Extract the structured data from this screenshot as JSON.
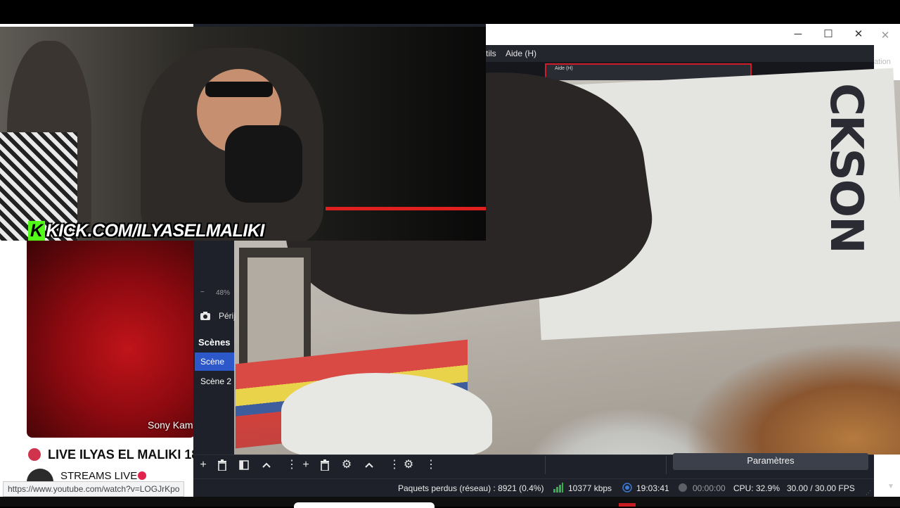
{
  "browser": {
    "video_caption": "Sony Kam",
    "live_title": "LIVE ILYAS EL MALIKI 18",
    "channel_name": "STREAMS LIVE",
    "status_url": "https://www.youtube.com/watch?v=LOGJrKpo"
  },
  "overlay": {
    "kick_logo_k": "K",
    "kick_logo_text": "KICK.COM/ILYASELMALIKI"
  },
  "obs": {
    "menu": {
      "tools_partial": "tils",
      "help": "Aide (H)"
    },
    "outer_window_partial_label": "ation",
    "nested_menu_label": "Aide (H)",
    "window_buttons": {
      "minimize": "─",
      "maximize": "☐",
      "close": "✕"
    },
    "outer_close": "✕",
    "preview": {
      "poster_text": "CKSON"
    },
    "zoom": {
      "minus": "−",
      "value": "48%"
    },
    "sources": {
      "first_label": "Périj"
    },
    "scenes": {
      "header": "Scènes",
      "items": [
        {
          "label": "Scène",
          "selected": true
        },
        {
          "label": "Scène 2",
          "selected": false
        }
      ]
    },
    "toolbar": {
      "settings_label": "Paramètres"
    },
    "status": {
      "dropped": "Paquets perdus (réseau) : 8921 (0.4%)",
      "bitrate": "10377 kbps",
      "live_time": "19:03:41",
      "rec_time": "00:00:00",
      "cpu": "CPU: 32.9%",
      "fps": "30.00 / 30.00 FPS"
    }
  },
  "colors": {
    "obs_bg": "#1f212a",
    "selected_scene": "#2d58c9",
    "kick_green": "#53fc18",
    "live_red": "#d0344c",
    "bitrate_green": "#2fb344",
    "live_blue": "#3a7bd5"
  }
}
